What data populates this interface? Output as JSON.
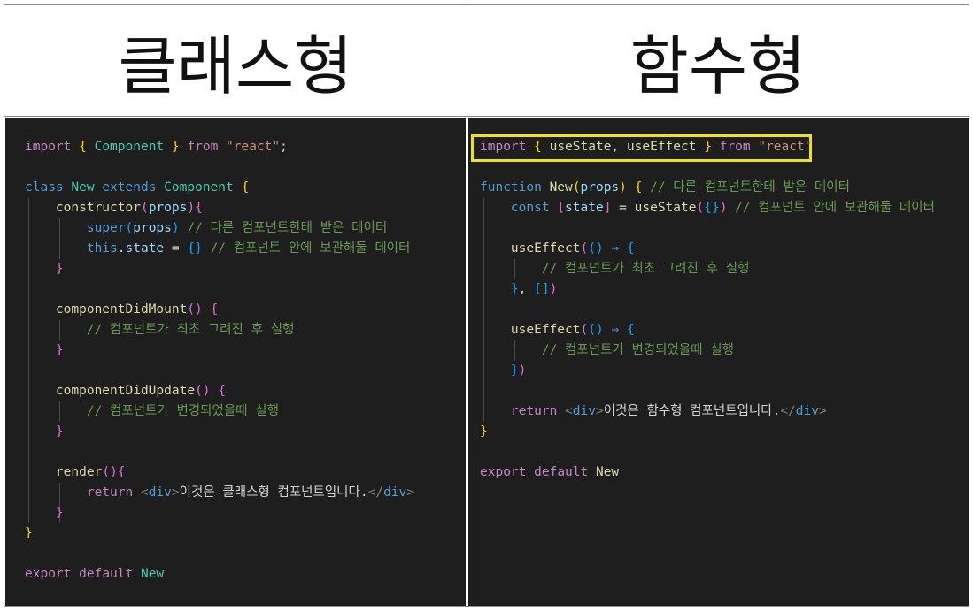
{
  "headers": {
    "class_title": "클래스형",
    "function_title": "함수형"
  },
  "colors": {
    "highlight_border": "#f0e020",
    "editor_bg": "#1e1e1e"
  },
  "left_code": {
    "l1_import": "import",
    "l1_component": "Component",
    "l1_from": "from",
    "l1_react": "\"react\"",
    "l3_class": "class",
    "l3_new": "New",
    "l3_extends": "extends",
    "l3_component": "Component",
    "l4_constructor": "constructor",
    "l4_props": "props",
    "l5_super": "super",
    "l5_props": "props",
    "l5_comment": "// 다른 컴포넌트한테 받은 데이터",
    "l6_this": "this",
    "l6_state": "state",
    "l6_comment": "// 컴포넌트 안에 보관해둘 데이터",
    "l9_mount": "componentDidMount",
    "l10_comment": "// 컴포넌트가 최초 그려진 후 실행",
    "l13_update": "componentDidUpdate",
    "l14_comment": "// 컴포넌트가 변경되었을때 실행",
    "l17_render": "render",
    "l18_return": "return",
    "l18_tag": "div",
    "l18_text": "이것은 클래스형 컴포넌트입니다.",
    "l22_export": "export",
    "l22_default": "default",
    "l22_new": "New"
  },
  "right_code": {
    "l1_import": "import",
    "l1_usestate": "useState",
    "l1_useeffect": "useEffect",
    "l1_from": "from",
    "l1_react": "\"react\"",
    "l3_function": "function",
    "l3_new": "New",
    "l3_props": "props",
    "l3_comment": "// 다른 컴포넌트한테 받은 데이터",
    "l4_const": "const",
    "l4_state": "state",
    "l4_usestate": "useState",
    "l4_comment": "// 컴포넌트 안에 보관해둘 데이터",
    "l6_useeffect": "useEffect",
    "l7_comment": "// 컴포넌트가 최초 그려진 후 실행",
    "l10_useeffect": "useEffect",
    "l11_comment": "// 컴포넌트가 변경되었을때 실행",
    "l14_return": "return",
    "l14_tag": "div",
    "l14_text": "이것은 함수형 컴포넌트입니다.",
    "l17_export": "export",
    "l17_default": "default",
    "l17_new": "New"
  }
}
